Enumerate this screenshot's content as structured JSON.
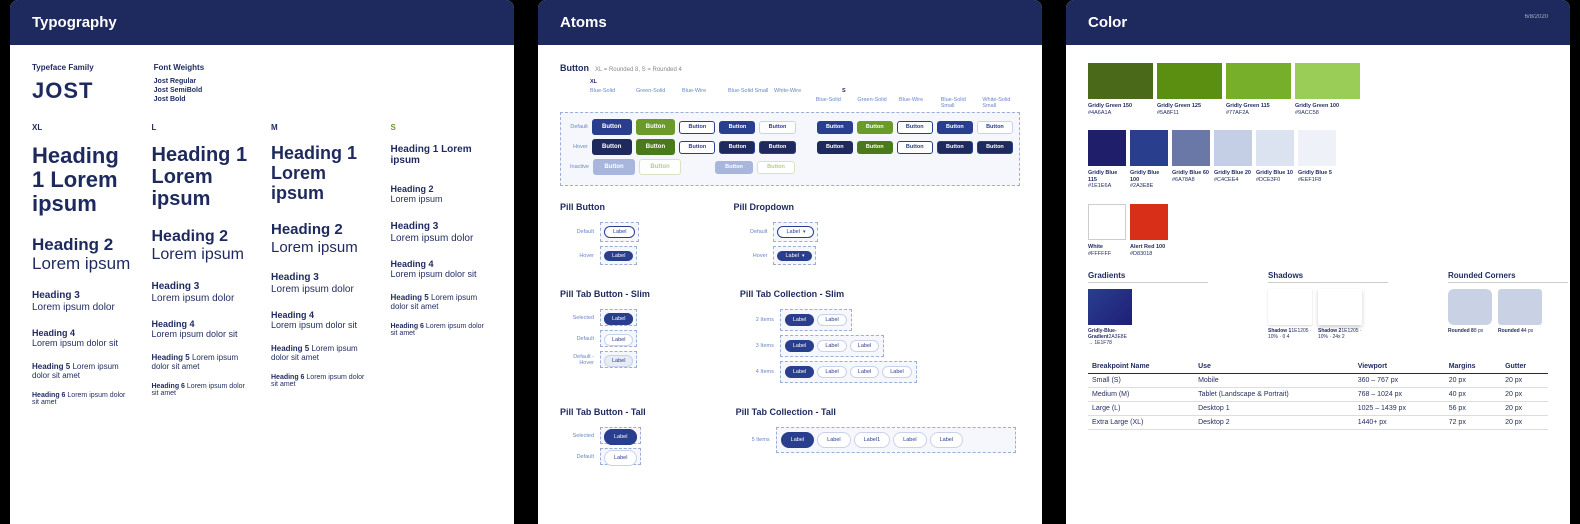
{
  "typography": {
    "title": "Typography",
    "typeface_label": "Typeface Family",
    "typeface_name": "JOST",
    "weights_label": "Font Weights",
    "weights": [
      "Jost Regular",
      "Jost SemiBold",
      "Jost Bold"
    ],
    "sizes": [
      "XL",
      "L",
      "M",
      "S"
    ],
    "h1": "Heading 1 Lorem ipsum",
    "h2_a": "Heading 2",
    "h2_b": "Lorem ipsum",
    "h3_a": "Heading 3",
    "h3_b": "Lorem ipsum dolor",
    "h4_a": "Heading 4",
    "h4_b": "Lorem ipsum dolor sit",
    "h5_a": "Heading 5",
    "h5_b": "Lorem ipsum dolor sit amet",
    "h6_a": "Heading 6",
    "h6_b": "Lorem ipsum dolor sit amet"
  },
  "atoms": {
    "title": "Atoms",
    "button_label": "Button",
    "button_meta": "XL = Rounded 8, S = Rounded 4",
    "size_xl": "XL",
    "size_s": "S",
    "cols": {
      "blue_solid": "Blue-Solid",
      "green_solid": "Green-Solid",
      "blue_wire": "Blue-Wire",
      "blue_solid_small": "Blue-Solid Small",
      "white_wire": "White-Wire",
      "white_solid_small": "White-Solid Small"
    },
    "rows": {
      "default": "Default",
      "hover": "Hover",
      "inactive": "Inactive"
    },
    "btn_text": "Button",
    "pill_button": "Pill Button",
    "pill_dropdown": "Pill Dropdown",
    "label": "Label",
    "tab_button_slim": "Pill Tab Button - Slim",
    "tab_collection_slim": "Pill Tab Collection - Slim",
    "tab_button_tall": "Pill Tab Button - Tall",
    "tab_collection_tall": "Pill Tab Collection - Tall",
    "selected": "Selected",
    "default_hover": "Default - Hover",
    "items2": "2 Items",
    "items3": "3 Items",
    "items4": "4 Items",
    "items5": "5 Items",
    "label1": "Label1"
  },
  "color": {
    "title": "Color",
    "page": "6/8/2020",
    "greens": [
      {
        "name": "Gridly Green 150",
        "hex": "#4A6A1A",
        "swatch": "#4a6a1a"
      },
      {
        "name": "Gridly Green 125",
        "hex": "#5A8F11",
        "swatch": "#5a8f11"
      },
      {
        "name": "Gridly Green 115",
        "hex": "#77AF2A",
        "swatch": "#77af2a"
      },
      {
        "name": "Gridly Green 100",
        "hex": "#9ACC58",
        "swatch": "#9acc58"
      }
    ],
    "blues": [
      {
        "name": "Gridly Blue 115",
        "hex": "#1E1E6A",
        "swatch": "#1e1e6a"
      },
      {
        "name": "Gridly Blue 100",
        "hex": "#2A3E8E",
        "swatch": "#2a3e8e"
      },
      {
        "name": "Gridly Blue 60",
        "hex": "#6A78A8",
        "swatch": "#6a78a8"
      },
      {
        "name": "Gridly Blue 20",
        "hex": "#C4CEE4",
        "swatch": "#c4cee4"
      },
      {
        "name": "Gridly Blue 10",
        "hex": "#DCE3F0",
        "swatch": "#dce3f0"
      },
      {
        "name": "Gridly Blue 5",
        "hex": "#EEF1F8",
        "swatch": "#eef1f8"
      }
    ],
    "extras": [
      {
        "name": "White",
        "hex": "#FFFFFF",
        "swatch": "#ffffff",
        "border": "1"
      },
      {
        "name": "Alert Red 100",
        "hex": "#D83018",
        "swatch": "#d83018"
      }
    ],
    "gradients_label": "Gradients",
    "gradient": {
      "name": "Gridly-Blue-Gradient",
      "meta": "2A3E8E → 1E1F78"
    },
    "shadows_label": "Shadows",
    "shadows": [
      {
        "name": "Shadow 1",
        "meta": "1E1205 · 10% · 0 4"
      },
      {
        "name": "Shadow 2",
        "meta": "1E1205 · 10% · 24x 2"
      }
    ],
    "rounded_label": "Rounded Corners",
    "rounded": [
      {
        "name": "Rounded 8",
        "meta": "8 px"
      },
      {
        "name": "Rounded 4",
        "meta": "4 px"
      }
    ],
    "table": {
      "headers": [
        "Breakpoint Name",
        "Use",
        "Viewport",
        "Margins",
        "Gutter"
      ],
      "rows": [
        [
          "Small (S)",
          "Mobile",
          "360 – 767 px",
          "20 px",
          "20 px"
        ],
        [
          "Medium (M)",
          "Tablet (Landscape & Portrait)",
          "768 – 1024 px",
          "40 px",
          "20 px"
        ],
        [
          "Large (L)",
          "Desktop 1",
          "1025 – 1439 px",
          "56 px",
          "20 px"
        ],
        [
          "Extra Large (XL)",
          "Desktop 2",
          "1440+ px",
          "72 px",
          "20 px"
        ]
      ]
    }
  }
}
